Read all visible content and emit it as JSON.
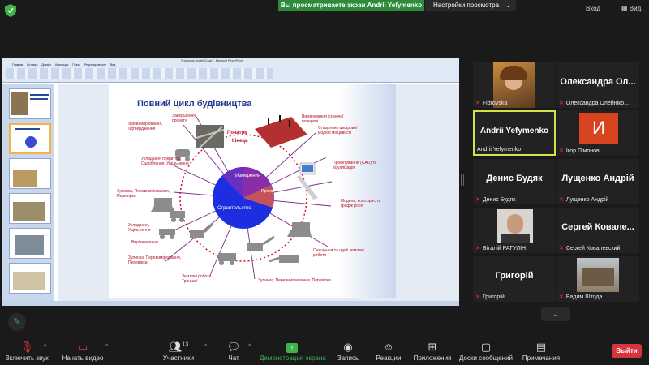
{
  "top": {
    "share_banner": "Вы просматриваете экран Andrii Yefymenko",
    "view_options": "Настройки просмотра",
    "exit_label": "Вход",
    "view_label": "Вид"
  },
  "shared_screen": {
    "window_title": "Прийомна Modell (Сaдн) - Microsoft PowerPoint",
    "ribbon_tabs": "Главная Вставка Дизайн Анимация Показ Рецензирование Вид",
    "slide": {
      "title": "Повний цикл будівництва",
      "center_labels": {
        "top_left": "Початок",
        "top_right": "Кінець",
        "sector_1": "Измерения",
        "sector_2": "Проект",
        "sector_3": "Строительство"
      },
      "labels": {
        "l1": "Перевнімірювання, Підтвердження",
        "l2": "Завершення проекту",
        "l3": "Вимірювання існуючої поверхні",
        "l4": "Створення цифрової моделі місцевості",
        "l5": "Укладання покриття, Оздоблення, Ущільнення",
        "l6": "Проектування (CAD) та візуалізація",
        "l7": "Зупинка, Перевимірювання, Перевірка",
        "l8": "Модель, кошторис та графік робіт",
        "l9": "Укладання, Ущільнення",
        "l10": "Вирівнювання",
        "l11": "Зупинка, Перевимірювання, Перевірка",
        "l12": "Очищення та грубі земляні роботи",
        "l13": "Земляні роботи, Траншеї",
        "l14": "Зупинка, Перевимірювання, Перевірка"
      }
    }
  },
  "participants": [
    {
      "name": "",
      "caption": "Fidrovska",
      "video": true
    },
    {
      "name": "Олександра Ол...",
      "caption": "Олександра Олейніко...",
      "video": false
    },
    {
      "name": "Andrii Yefymenko",
      "caption": "Andrii Yefymenko",
      "video": false,
      "speaking": true
    },
    {
      "name": "И",
      "caption": "Ігор Пімонов",
      "video": false,
      "avatar": true
    },
    {
      "name": "Денис Будяк",
      "caption": "Денис Будяк",
      "video": false
    },
    {
      "name": "Лущенко Андрій",
      "caption": "Лущенко Андрій",
      "video": false
    },
    {
      "name": "",
      "caption": "Віталій РАГУЛІН",
      "video": true
    },
    {
      "name": "Сергей Ковале...",
      "caption": "Сергей Ковалевский",
      "video": false
    },
    {
      "name": "Григорій",
      "caption": "Григорій",
      "video": false
    },
    {
      "name": "",
      "caption": "Вадим Штода",
      "video": true
    }
  ],
  "toolbar": {
    "mute": "Включить звук",
    "video": "Начать видео",
    "participants": "Участники",
    "participants_count": "13",
    "chat": "Чат",
    "share": "Демонстрация экрана",
    "record": "Запись",
    "reactions": "Реакции",
    "apps": "Приложения",
    "whiteboards": "Доски сообщений",
    "notes": "Примечания",
    "leave": "Выйти"
  },
  "colors": {
    "share_green": "#2d8c3c",
    "leave_red": "#d6353f",
    "avatar_red": "#d84420",
    "speaker_border": "#d6e04a"
  }
}
